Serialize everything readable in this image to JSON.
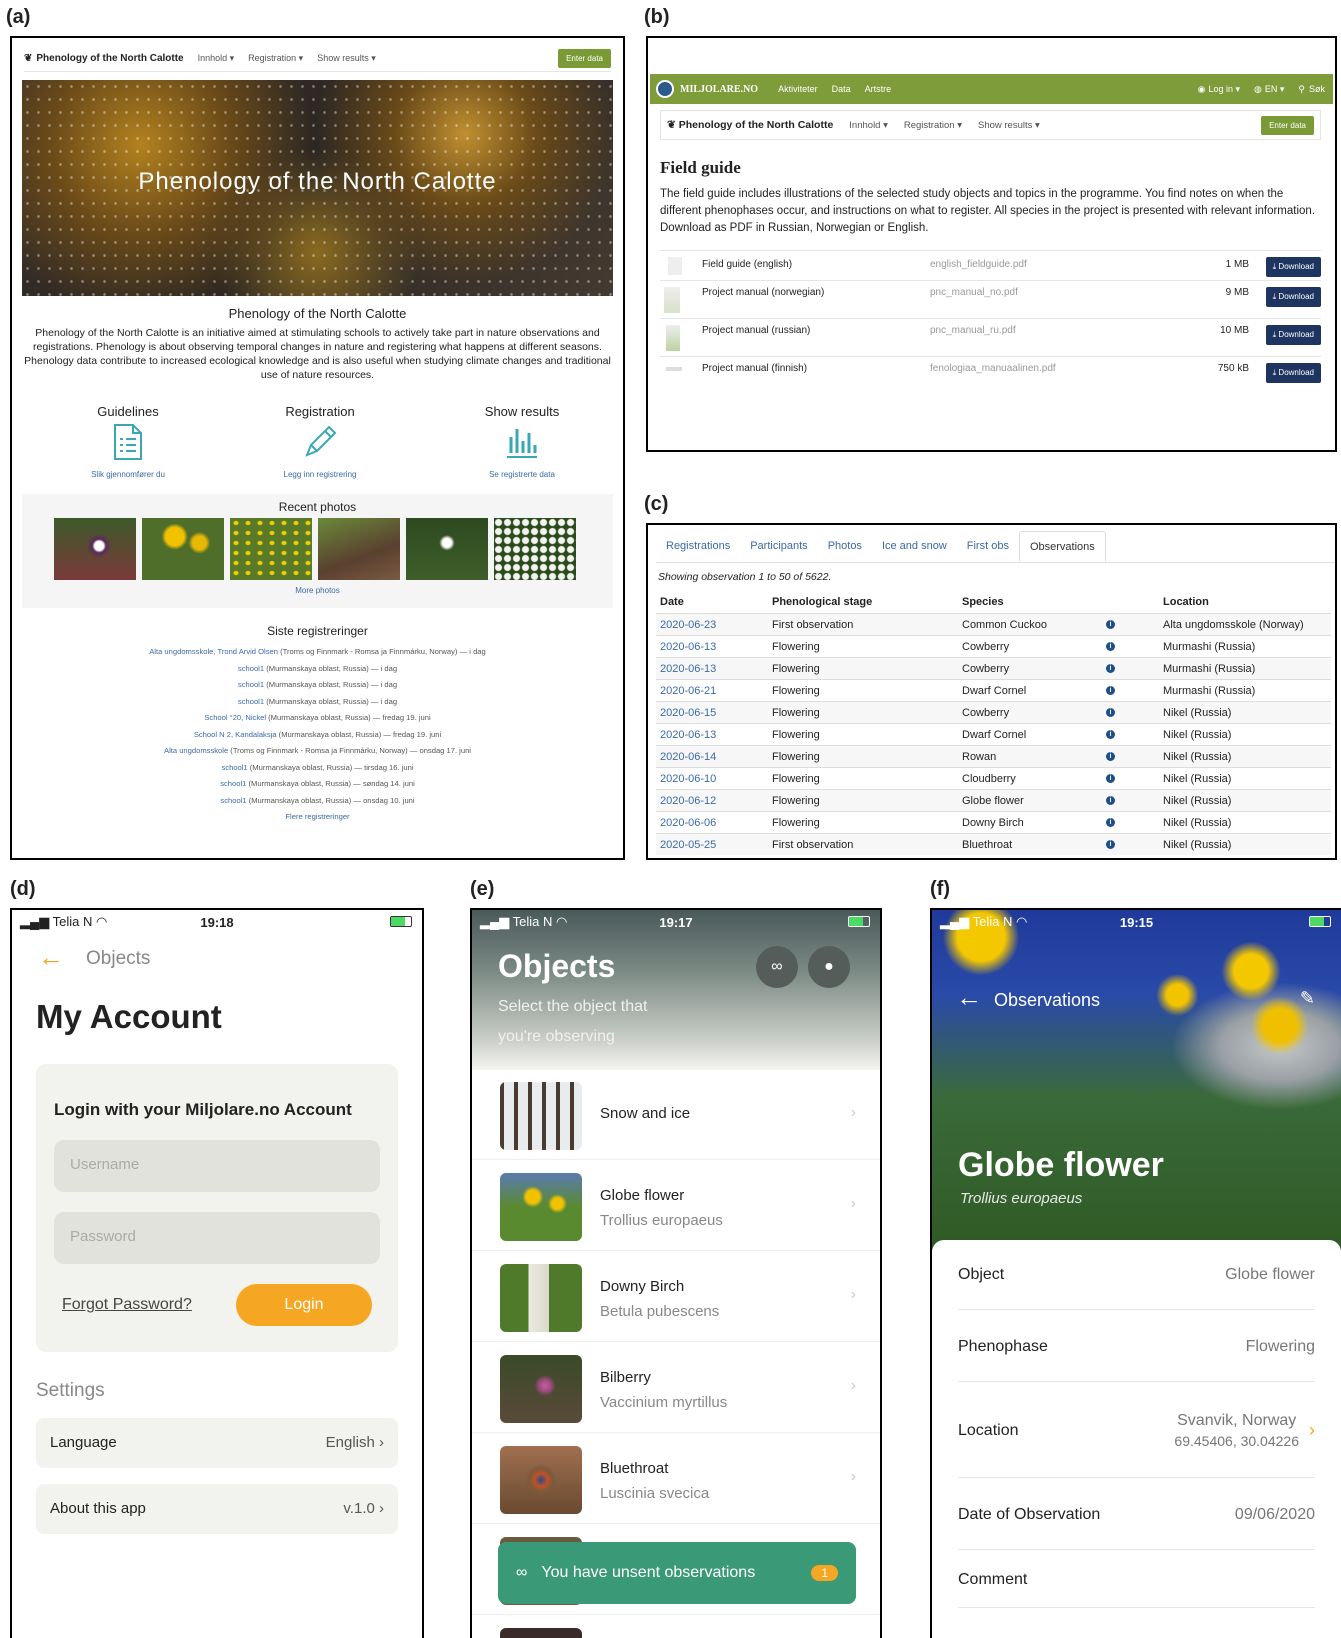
{
  "panel_labels": {
    "a": "(a)",
    "b": "(b)",
    "c": "(c)",
    "d": "(d)",
    "e": "(e)",
    "f": "(f)"
  },
  "a": {
    "nav": {
      "brand": "Phenology of the North Calotte",
      "items": [
        "Innhold ▾",
        "Registration ▾",
        "Show results ▾"
      ],
      "enter": "Enter data"
    },
    "hero_title": "Phenology of the North Calotte",
    "heading": "Phenology of the North Calotte",
    "intro": "Phenology of the North Calotte is an initiative aimed at stimulating schools to actively take part in nature observations and registrations. Phenology is about observing temporal changes in nature and registering what happens at different seasons. Phenology data contribute to increased ecological knowledge and is also useful when studying climate changes and traditional use of nature resources.",
    "cols": [
      {
        "title": "Guidelines",
        "sub": "Slik gjennomfører du"
      },
      {
        "title": "Registration",
        "sub": "Legg inn registrering"
      },
      {
        "title": "Show results",
        "sub": "Se registrerte data"
      }
    ],
    "recent_title": "Recent photos",
    "more_photos": "More photos",
    "siste_title": "Siste registreringer",
    "siste": [
      {
        "l": "Alta ungdomsskole, Trond Arvid Olsen",
        "r": " (Troms og Finnmark - Romsa ja Finnmárku, Norway) — i dag"
      },
      {
        "l": "school1",
        "r": " (Murmanskaya oblast, Russia) — i dag"
      },
      {
        "l": "school1",
        "r": " (Murmanskaya oblast, Russia) — i dag"
      },
      {
        "l": "school1",
        "r": " (Murmanskaya oblast, Russia) — i dag"
      },
      {
        "l": "School °20, Nickel",
        "r": " (Murmanskaya oblast, Russia) — fredag 19. juni"
      },
      {
        "l": "School N 2, Kandalaksja",
        "r": " (Murmanskaya oblast, Russia) — fredag 19. juni"
      },
      {
        "l": "Alta ungdomsskole",
        "r": " (Troms og Finnmark - Romsa ja Finnmárku, Norway) — onsdag 17. juni"
      },
      {
        "l": "school1",
        "r": " (Murmanskaya oblast, Russia) — tirsdag 16. juni"
      },
      {
        "l": "school1",
        "r": " (Murmanskaya oblast, Russia) — søndag 14. juni"
      },
      {
        "l": "school1",
        "r": " (Murmanskaya oblast, Russia) — onsdag 10. juni"
      }
    ],
    "flere": "Flere registreringer"
  },
  "b": {
    "bar": {
      "logo": "MILJOLARE.NO",
      "items": [
        "Aktiviteter",
        "Data",
        "Artstre"
      ],
      "login": "Log in ▾",
      "lang": "EN ▾",
      "search": "Søk"
    },
    "nav": {
      "brand": "Phenology of the North Calotte",
      "items": [
        "Innhold ▾",
        "Registration ▾",
        "Show results ▾"
      ],
      "enter": "Enter data"
    },
    "title": "Field guide",
    "text": "The field guide includes illustrations of the selected study objects and topics in the programme. You find notes on when the different phenophases occur, and instructions on what to register. All species in the project is presented with relevant information. Download as PDF in Russian, Norwegian or English.",
    "rows": [
      {
        "name": "Field guide (english)",
        "file": "english_fieldguide.pdf",
        "size": "1 MB"
      },
      {
        "name": "Project manual (norwegian)",
        "file": "pnc_manual_no.pdf",
        "size": "9 MB"
      },
      {
        "name": "Project manual (russian)",
        "file": "pnc_manual_ru.pdf",
        "size": "10 MB"
      },
      {
        "name": "Project manual (finnish)",
        "file": "fenologiaa_manuaalinen.pdf",
        "size": "750 kB"
      }
    ],
    "download": "Download"
  },
  "c": {
    "tabs": [
      "Registrations",
      "Participants",
      "Photos",
      "Ice and snow",
      "First obs",
      "Observations"
    ],
    "showing": "Showing observation 1 to 50 of 5622.",
    "headers": [
      "Date",
      "Phenological stage",
      "Species",
      "Location"
    ],
    "info_glyph": "i",
    "rows": [
      [
        "2020-06-23",
        "First observation",
        "Common Cuckoo",
        "Alta ungdomsskole (Norway)"
      ],
      [
        "2020-06-13",
        "Flowering",
        "Cowberry",
        "Murmashi (Russia)"
      ],
      [
        "2020-06-13",
        "Flowering",
        "Cowberry",
        "Murmashi (Russia)"
      ],
      [
        "2020-06-21",
        "Flowering",
        "Dwarf Cornel",
        "Murmashi (Russia)"
      ],
      [
        "2020-06-15",
        "Flowering",
        "Cowberry",
        "Nikel (Russia)"
      ],
      [
        "2020-06-13",
        "Flowering",
        "Dwarf Cornel",
        "Nikel (Russia)"
      ],
      [
        "2020-06-14",
        "Flowering",
        "Rowan",
        "Nikel (Russia)"
      ],
      [
        "2020-06-10",
        "Flowering",
        "Cloudberry",
        "Nikel (Russia)"
      ],
      [
        "2020-06-12",
        "Flowering",
        "Globe flower",
        "Nikel (Russia)"
      ],
      [
        "2020-06-06",
        "Flowering",
        "Downy Birch",
        "Nikel (Russia)"
      ],
      [
        "2020-05-25",
        "First observation",
        "Bluethroat",
        "Nikel (Russia)"
      ]
    ]
  },
  "d": {
    "status": {
      "carrier": "Telia N",
      "time": "19:18"
    },
    "back": "Objects",
    "title": "My Account",
    "login_title": "Login with your Miljolare.no Account",
    "username_ph": "Username",
    "password_ph": "Password",
    "forgot": "Forgot Password?",
    "login": "Login",
    "settings": "Settings",
    "language": {
      "label": "Language",
      "value": "English"
    },
    "about": {
      "label": "About this app",
      "value": "v.1.0"
    }
  },
  "e": {
    "status": {
      "carrier": "Telia N",
      "time": "19:17"
    },
    "title": "Objects",
    "sub1": "Select the object that",
    "sub2": "you're observing",
    "items": [
      {
        "name": "Snow and ice",
        "latin": ""
      },
      {
        "name": "Globe flower",
        "latin": "Trollius europaeus"
      },
      {
        "name": "Downy Birch",
        "latin": "Betula pubescens"
      },
      {
        "name": "Bilberry",
        "latin": "Vaccinium myrtillus"
      },
      {
        "name": "Bluethroat",
        "latin": "Luscinia svecica"
      }
    ],
    "unsent": "You have unsent observations",
    "unsent_count": "1"
  },
  "f": {
    "status": {
      "carrier": "Telia N",
      "time": "19:15"
    },
    "back": "Observations",
    "title": "Globe flower",
    "latin": "Trollius europaeus",
    "rows": [
      {
        "k": "Object",
        "v": "Globe flower"
      },
      {
        "k": "Phenophase",
        "v": "Flowering"
      }
    ],
    "location": {
      "k": "Location",
      "v1": "Svanvik, Norway",
      "v2": "69.45406, 30.04226"
    },
    "date": {
      "k": "Date of Observation",
      "v": "09/06/2020"
    },
    "comment": "Comment"
  },
  "colors": {
    "accent_green": "#7f9c3a",
    "download_navy": "#1d3560",
    "orange": "#f5a623",
    "teal": "#3a9a77"
  }
}
